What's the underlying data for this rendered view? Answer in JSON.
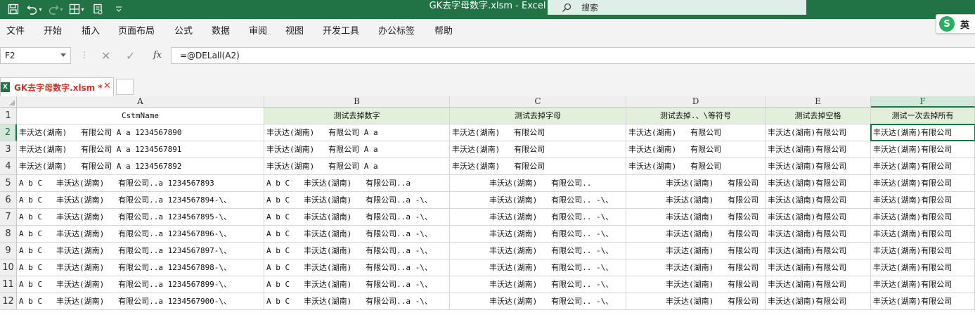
{
  "titlebar": {
    "doc_title": "GK去字母数字.xlsm  -  Excel",
    "search_placeholder": "搜索",
    "qat": [
      "save-icon",
      "undo-icon",
      "redo-icon",
      "borders-icon",
      "format-painter-icon",
      "customize-icon"
    ]
  },
  "ribbon": {
    "tabs": [
      "文件",
      "开始",
      "插入",
      "页面布局",
      "公式",
      "数据",
      "审阅",
      "视图",
      "开发工具",
      "办公标签",
      "帮助"
    ],
    "ime_lang": "英"
  },
  "formula_bar": {
    "name_box": "F2",
    "cancel_symbol": "✕",
    "enter_symbol": "✓",
    "fx_label": "fx",
    "formula": "=@DELall(A2)"
  },
  "workbook_tab": {
    "name": "GK去字母数字.xlsm *",
    "close": "✕",
    "file_badge": "X"
  },
  "sheet": {
    "selected_cell": "F2",
    "columns": [
      "A",
      "B",
      "C",
      "D",
      "E",
      "F"
    ],
    "rows": [
      "1",
      "2",
      "3",
      "4",
      "5",
      "6",
      "7",
      "8",
      "9",
      "10",
      "11",
      "12"
    ],
    "header_row": [
      "CstmName",
      "测试去掉数字",
      "测试去掉字母",
      "测试去掉.、\\等符号",
      "测试去掉空格",
      "测试一次去掉所有"
    ],
    "data": [
      [
        "丰沃达(湖南)   有限公司 A a 1234567890",
        "丰沃达(湖南)   有限公司 A a",
        "丰沃达(湖南)   有限公司",
        "丰沃达(湖南)   有限公司",
        "丰沃达(湖南)有限公司",
        "丰沃达(湖南)有限公司"
      ],
      [
        "丰沃达(湖南)   有限公司 A a 1234567891",
        "丰沃达(湖南)   有限公司 A a",
        "丰沃达(湖南)   有限公司",
        "丰沃达(湖南)   有限公司",
        "丰沃达(湖南)有限公司",
        "丰沃达(湖南)有限公司"
      ],
      [
        "丰沃达(湖南)   有限公司 A a 1234567892",
        "丰沃达(湖南)   有限公司 A a",
        "丰沃达(湖南)   有限公司",
        "丰沃达(湖南)   有限公司",
        "丰沃达(湖南)有限公司",
        "丰沃达(湖南)有限公司"
      ],
      [
        "A b C   丰沃达(湖南)   有限公司..a 1234567893",
        "A b C   丰沃达(湖南)   有限公司..a",
        "        丰沃达(湖南)   有限公司..",
        "        丰沃达(湖南)   有限公司",
        "丰沃达(湖南)有限公司",
        "丰沃达(湖南)有限公司"
      ],
      [
        "A b C   丰沃达(湖南)   有限公司..a 1234567894-\\、",
        "A b C   丰沃达(湖南)   有限公司..a -\\、",
        "        丰沃达(湖南)   有限公司.. -\\、",
        "        丰沃达(湖南)   有限公司",
        "丰沃达(湖南)有限公司",
        "丰沃达(湖南)有限公司"
      ],
      [
        "A b C   丰沃达(湖南)   有限公司..a 1234567895-\\、",
        "A b C   丰沃达(湖南)   有限公司..a -\\、",
        "        丰沃达(湖南)   有限公司.. -\\、",
        "        丰沃达(湖南)   有限公司",
        "丰沃达(湖南)有限公司",
        "丰沃达(湖南)有限公司"
      ],
      [
        "A b C   丰沃达(湖南)   有限公司..a 1234567896-\\、",
        "A b C   丰沃达(湖南)   有限公司..a -\\、",
        "        丰沃达(湖南)   有限公司.. -\\、",
        "        丰沃达(湖南)   有限公司",
        "丰沃达(湖南)有限公司",
        "丰沃达(湖南)有限公司"
      ],
      [
        "A b C   丰沃达(湖南)   有限公司..a 1234567897-\\、",
        "A b C   丰沃达(湖南)   有限公司..a -\\、",
        "        丰沃达(湖南)   有限公司.. -\\、",
        "        丰沃达(湖南)   有限公司",
        "丰沃达(湖南)有限公司",
        "丰沃达(湖南)有限公司"
      ],
      [
        "A b C   丰沃达(湖南)   有限公司..a 1234567898-\\、",
        "A b C   丰沃达(湖南)   有限公司..a -\\、",
        "        丰沃达(湖南)   有限公司.. -\\、",
        "        丰沃达(湖南)   有限公司",
        "丰沃达(湖南)有限公司",
        "丰沃达(湖南)有限公司"
      ],
      [
        "A b C   丰沃达(湖南)   有限公司..a 1234567899-\\、",
        "A b C   丰沃达(湖南)   有限公司..a -\\、",
        "        丰沃达(湖南)   有限公司.. -\\、",
        "        丰沃达(湖南)   有限公司",
        "丰沃达(湖南)有限公司",
        "丰沃达(湖南)有限公司"
      ],
      [
        "A b C   丰沃达(湖南)   有限公司..a 1234567900-\\、",
        "A b C   丰沃达(湖南)   有限公司..a -\\、",
        "        丰沃达(湖南)   有限公司.. -\\、",
        "        丰沃达(湖南)   有限公司",
        "丰沃达(湖南)有限公司",
        "丰沃达(湖南)有限公司"
      ]
    ]
  },
  "colors": {
    "excel_green": "#217346",
    "header_fill": "#e2efda",
    "tab_text": "#c0392b"
  }
}
